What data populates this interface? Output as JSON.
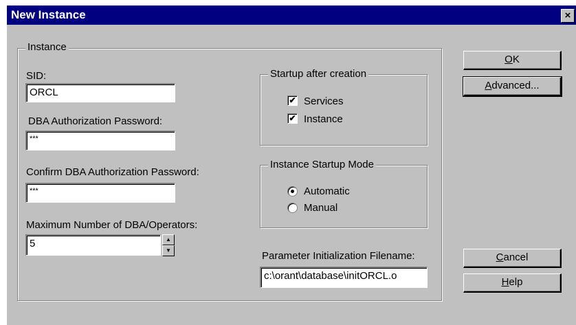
{
  "window": {
    "title": "New Instance",
    "close_glyph": "×"
  },
  "instance_group": {
    "title": "Instance",
    "sid_label": "SID:",
    "sid_value": "ORCL",
    "dba_password_label": "DBA Authorization Password:",
    "dba_password_value": "***",
    "confirm_password_label": "Confirm DBA Authorization Password:",
    "confirm_password_value": "***",
    "max_operators_label": "Maximum Number of DBA/Operators:",
    "max_operators_value": "5"
  },
  "startup_after_creation": {
    "title": "Startup after creation",
    "services_label": "Services",
    "services_checked": true,
    "instance_label": "Instance",
    "instance_checked": true
  },
  "startup_mode": {
    "title": "Instance Startup Mode",
    "automatic_label": "Automatic",
    "manual_label": "Manual",
    "selected": "Automatic"
  },
  "param_file": {
    "label": "Parameter Initialization Filename:",
    "value": "c:\\orant\\database\\initORCL.o"
  },
  "buttons": {
    "ok_mnemonic": "O",
    "ok_rest": "K",
    "advanced_mnemonic": "A",
    "advanced_rest": "dvanced...",
    "cancel_mnemonic": "C",
    "cancel_rest": "ancel",
    "help_mnemonic": "H",
    "help_rest": "elp"
  },
  "icons": {
    "check_glyph": "✔",
    "spin_up_glyph": "▲",
    "spin_down_glyph": "▼"
  },
  "colors": {
    "titlebar": "#000080",
    "face": "#c0c0c0"
  }
}
